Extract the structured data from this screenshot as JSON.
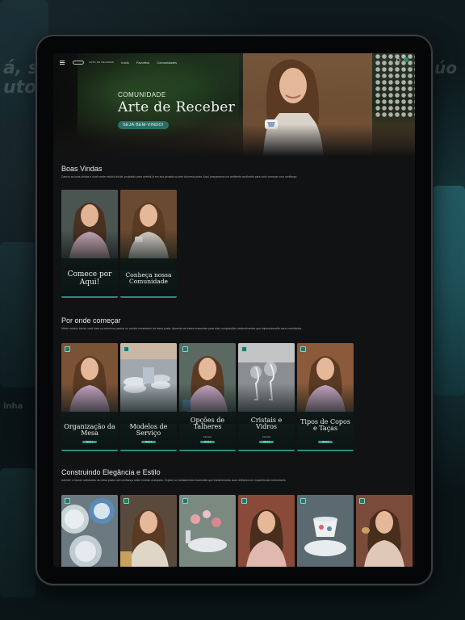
{
  "app": {
    "logo_text": "ARTE DE RECEBER",
    "nav": {
      "items": [
        "Início",
        "Favoritos",
        "Comunidades"
      ]
    }
  },
  "hero": {
    "kicker": "COMUNIDADE",
    "title": "Arte de Receber",
    "button_label": "SEJA BEM-VINDO!"
  },
  "background": {
    "text_left_1": "á, s",
    "text_left_2": "uto",
    "text_left_3": "inha",
    "text_right": "úo"
  },
  "sections": [
    {
      "title": "Boas Vindas",
      "description": "Damos as boas-vindas a você neste módulo inicial, projetado para orientá-lo em sua jornada na arte da mesa posta. Aqui, preparamos um ambiente acolhedor para você começar com confiança.",
      "cards": [
        {
          "label": "Comece por Aqui!"
        },
        {
          "label": "Conheça nossa Comunidade"
        }
      ]
    },
    {
      "title": "Por onde começar",
      "description": "Neste módulo inicial, você dará os primeiros passos no mundo encantador da mesa posta. Aprenda as bases essenciais para criar composições deslumbrantes que impressionarão seus convidados.",
      "cards": [
        {
          "label": "Organização da Mesa",
          "sub": "",
          "pill": "AULA 1"
        },
        {
          "label": "Modelos de Serviço",
          "sub": "",
          "pill": "AULA 2"
        },
        {
          "label": "Opções de Talheres",
          "sub": "Intensivo",
          "pill": "AULA 3"
        },
        {
          "label": "Cristais e Vidros",
          "sub": "Intensivo",
          "pill": "AULA 4"
        },
        {
          "label": "Tipos de Copos e Taças",
          "sub": "",
          "pill": "AULA 5"
        }
      ]
    },
    {
      "title": "Construindo Elegância e Estilo",
      "description": "Adentre o mundo sofisticado da mesa posta com confiança neste módulo avançado. Explore os fundamentos essenciais que transformarão suas refeições em experiências memoráveis.",
      "cards": [
        {},
        {},
        {},
        {},
        {},
        {}
      ]
    }
  ],
  "colors": {
    "accent": "#2b6e66",
    "card_border": "#2d8c80",
    "badge": "#1f7a6e",
    "screen_bg": "#111213"
  }
}
